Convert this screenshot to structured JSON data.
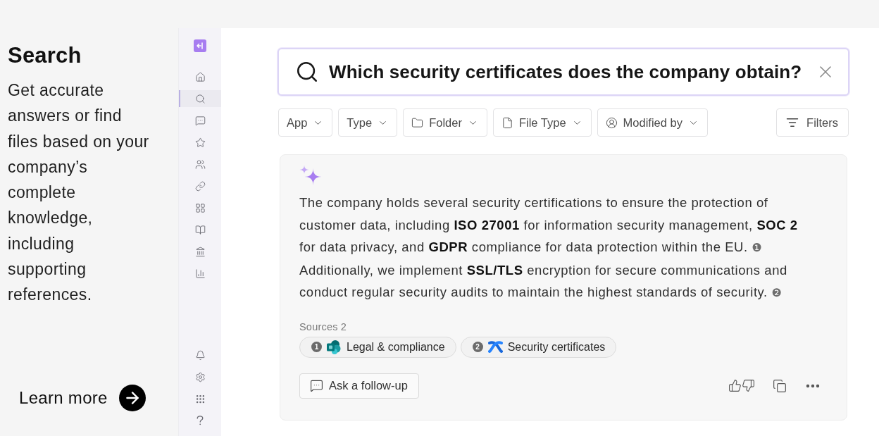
{
  "intro": {
    "title": "Search",
    "description": "Get accurate answers or find files based on your company’s complete knowledge, including supporting references.",
    "link": "Learn more"
  },
  "sidebar": {
    "nav": [
      {
        "selected": false
      },
      {
        "selected": true
      },
      {
        "selected": false
      },
      {
        "selected": false
      },
      {
        "selected": false
      },
      {
        "selected": false
      },
      {
        "selected": false
      },
      {
        "selected": false
      },
      {
        "selected": false
      },
      {
        "selected": false
      }
    ]
  },
  "search": {
    "value": "Which security certificates does the company obtain?"
  },
  "filters": [
    {
      "label": "App",
      "kind": "plain"
    },
    {
      "label": "Type",
      "kind": "plain"
    },
    {
      "label": "Folder",
      "kind": "folder"
    },
    {
      "label": "File Type",
      "kind": "file"
    },
    {
      "label": "Modified by",
      "kind": "person"
    }
  ],
  "filters_button": "Filters",
  "answer": {
    "text": "The company holds several security certifications to ensure the protection of customer data, including **ISO 27001** for information security management, **SOC 2** for data privacy, and **GDPR** compliance for data protection within the EU. ❶ Additionally, we implement **SSL/TLS** encryption for secure communications and conduct regular security audits to maintain the highest standards of security. ❷",
    "sources_label": "Sources 2",
    "sources": [
      {
        "number": "1",
        "title": "Legal & compliance",
        "kind": "sharepoint"
      },
      {
        "number": "2",
        "title": "Security certificates",
        "kind": "confluence"
      }
    ],
    "follow_up": "Ask a follow-up"
  }
}
